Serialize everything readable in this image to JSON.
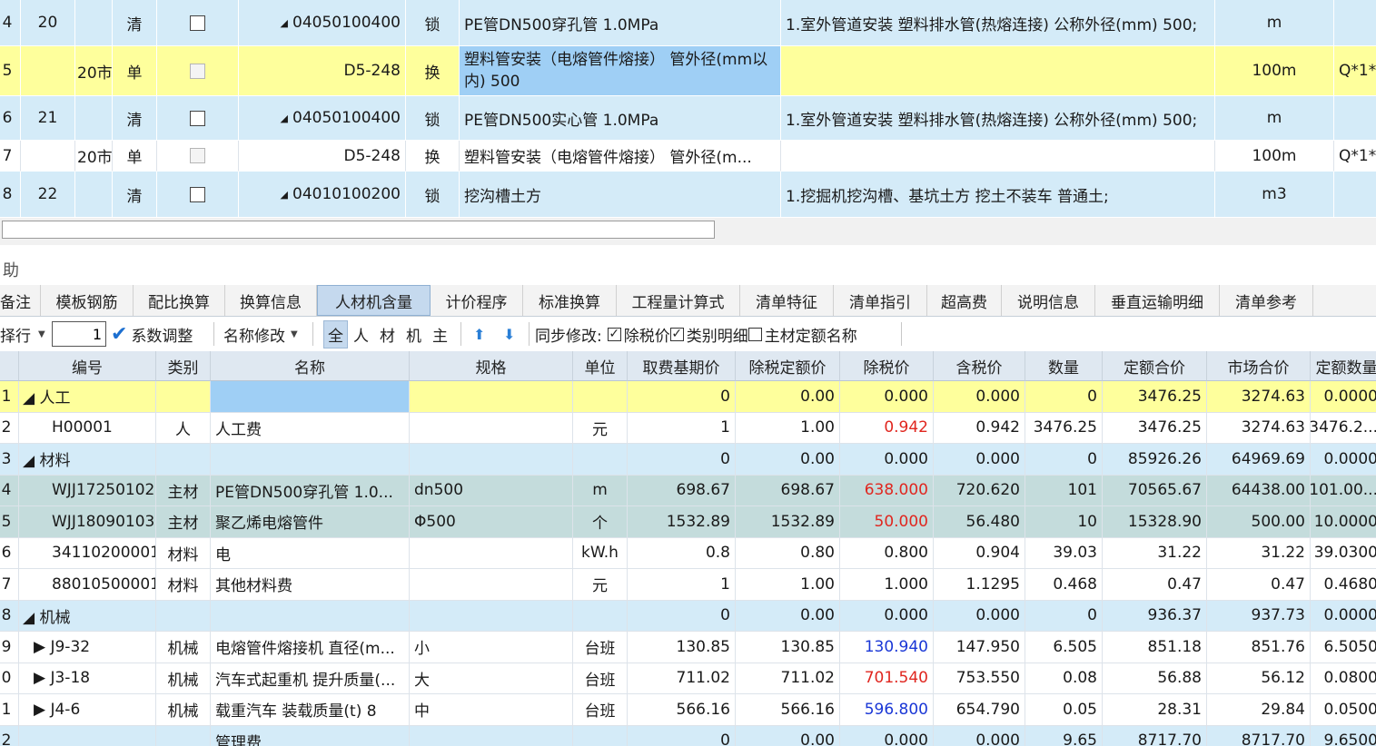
{
  "top_rows": [
    {
      "idx": "4",
      "seq": "20",
      "c2": "",
      "type": "清",
      "check": "unchecked",
      "expand": "◢",
      "code": "04050100400",
      "lock": "锁",
      "name": "PE管DN500穿孔管  1.0MPa",
      "feature": "1.室外管道安装 塑料排水管(热熔连接) 公称外径(mm) 500;",
      "unit": "m",
      "expr": "",
      "style": "blue"
    },
    {
      "idx": "5",
      "seq": "",
      "c2": "20市",
      "type": "单",
      "check": "disabled",
      "expand": "",
      "code": "D5-248",
      "lock": "换",
      "name": "塑料管安装（电熔管件熔接） 管外径(mm以内) 500",
      "feature": "",
      "unit": "100m",
      "expr": "Q*1*",
      "style": "yellow"
    },
    {
      "idx": "6",
      "seq": "21",
      "c2": "",
      "type": "清",
      "check": "unchecked",
      "expand": "◢",
      "code": "04050100400",
      "lock": "锁",
      "name": "PE管DN500实心管  1.0MPa",
      "feature": "1.室外管道安装 塑料排水管(热熔连接) 公称外径(mm) 500;",
      "unit": "m",
      "expr": "",
      "style": "blue"
    },
    {
      "idx": "7",
      "seq": "",
      "c2": "20市",
      "type": "单",
      "check": "disabled",
      "expand": "",
      "code": "D5-248",
      "lock": "换",
      "name": "塑料管安装（电熔管件熔接） 管外径(m...",
      "feature": "",
      "unit": "100m",
      "expr": "Q*1*",
      "style": "white"
    },
    {
      "idx": "8",
      "seq": "22",
      "c2": "",
      "type": "清",
      "check": "unchecked",
      "expand": "◢",
      "code": "04010100200",
      "lock": "锁",
      "name": "挖沟槽土方",
      "feature": "1.挖掘机挖沟槽、基坑土方 挖土不装车 普通土;",
      "unit": "m3",
      "expr": "",
      "style": "blue"
    }
  ],
  "panel": {
    "title": "助"
  },
  "tabs": [
    "备注",
    "模板钢筋",
    "配比换算",
    "换算信息",
    "人材机含量",
    "计价程序",
    "标准换算",
    "工程量计算式",
    "清单特征",
    "清单指引",
    "超高费",
    "说明信息",
    "垂直运输明细",
    "清单参考"
  ],
  "active_tab": "人材机含量",
  "toolbar": {
    "insert_label": "择行",
    "count_value": "1",
    "coef_label": "系数调整",
    "rename_label": "名称修改",
    "filters": [
      "全",
      "人",
      "材",
      "机",
      "主"
    ],
    "sync_label": "同步修改:",
    "opt1": "除税价",
    "opt2": "类别明细",
    "opt3": "主材定额名称"
  },
  "columns": [
    "",
    "编号",
    "类别",
    "名称",
    "规格",
    "单位",
    "取费基期价",
    "除税定额价",
    "除税价",
    "含税价",
    "数量",
    "定额合价",
    "市场合价",
    "定额数量"
  ],
  "rows": [
    {
      "idx": "1",
      "code": "◢ 人工",
      "cat": "",
      "name": "",
      "spec": "",
      "unit": "",
      "base": "0",
      "taxfree_quota": "0.00",
      "taxfree": "0.000",
      "tax": "0.000",
      "qty": "0",
      "quota_total": "3476.25",
      "market_total": "3274.63",
      "quota_qty": "0.0000",
      "style": "yellow",
      "price_color": "black"
    },
    {
      "idx": "2",
      "code": "H00001",
      "cat": "人",
      "name": "人工费",
      "spec": "",
      "unit": "元",
      "base": "1",
      "taxfree_quota": "1.00",
      "taxfree": "0.942",
      "tax": "0.942",
      "qty": "3476.25",
      "quota_total": "3476.25",
      "market_total": "3274.63",
      "quota_qty": "3476.2...",
      "style": "white",
      "price_color": "red"
    },
    {
      "idx": "3",
      "code": "◢ 材料",
      "cat": "",
      "name": "",
      "spec": "",
      "unit": "",
      "base": "0",
      "taxfree_quota": "0.00",
      "taxfree": "0.000",
      "tax": "0.000",
      "qty": "0",
      "quota_total": "85926.26",
      "market_total": "64969.69",
      "quota_qty": "0.0000",
      "style": "blue",
      "price_color": "black"
    },
    {
      "idx": "4",
      "code": "WJJ17250102",
      "cat": "主材",
      "name": "PE管DN500穿孔管  1.0...",
      "spec": "dn500",
      "unit": "m",
      "base": "698.67",
      "taxfree_quota": "698.67",
      "taxfree": "638.000",
      "tax": "720.620",
      "qty": "101",
      "quota_total": "70565.67",
      "market_total": "64438.00",
      "quota_qty": "101.00...",
      "style": "gray",
      "price_color": "red"
    },
    {
      "idx": "5",
      "code": "WJJ18090103",
      "cat": "主材",
      "name": "聚乙烯电熔管件",
      "spec": "Φ500",
      "unit": "个",
      "base": "1532.89",
      "taxfree_quota": "1532.89",
      "taxfree": "50.000",
      "tax": "56.480",
      "qty": "10",
      "quota_total": "15328.90",
      "market_total": "500.00",
      "quota_qty": "10.0000",
      "style": "gray",
      "price_color": "red"
    },
    {
      "idx": "6",
      "code": "34110200001",
      "cat": "材料",
      "name": "电",
      "spec": "",
      "unit": "kW.h",
      "base": "0.8",
      "taxfree_quota": "0.80",
      "taxfree": "0.800",
      "tax": "0.904",
      "qty": "39.03",
      "quota_total": "31.22",
      "market_total": "31.22",
      "quota_qty": "39.0300",
      "style": "white",
      "price_color": "black"
    },
    {
      "idx": "7",
      "code": "88010500001",
      "cat": "材料",
      "name": "其他材料费",
      "spec": "",
      "unit": "元",
      "base": "1",
      "taxfree_quota": "1.00",
      "taxfree": "1.000",
      "tax": "1.1295",
      "qty": "0.468",
      "quota_total": "0.47",
      "market_total": "0.47",
      "quota_qty": "0.4680",
      "style": "white",
      "price_color": "black"
    },
    {
      "idx": "8",
      "code": "◢ 机械",
      "cat": "",
      "name": "",
      "spec": "",
      "unit": "",
      "base": "0",
      "taxfree_quota": "0.00",
      "taxfree": "0.000",
      "tax": "0.000",
      "qty": "0",
      "quota_total": "936.37",
      "market_total": "937.73",
      "quota_qty": "0.0000",
      "style": "blue",
      "price_color": "black"
    },
    {
      "idx": "9",
      "code": "▶ J9-32",
      "cat": "机械",
      "name": "电熔管件熔接机 直径(m...",
      "spec": "小",
      "unit": "台班",
      "base": "130.85",
      "taxfree_quota": "130.85",
      "taxfree": "130.940",
      "tax": "147.950",
      "qty": "6.505",
      "quota_total": "851.18",
      "market_total": "851.76",
      "quota_qty": "6.5050",
      "style": "white",
      "price_color": "blue"
    },
    {
      "idx": "0",
      "code": "▶ J3-18",
      "cat": "机械",
      "name": "汽车式起重机 提升质量(...",
      "spec": "大",
      "unit": "台班",
      "base": "711.02",
      "taxfree_quota": "711.02",
      "taxfree": "701.540",
      "tax": "753.550",
      "qty": "0.08",
      "quota_total": "56.88",
      "market_total": "56.12",
      "quota_qty": "0.0800",
      "style": "white",
      "price_color": "red"
    },
    {
      "idx": "1",
      "code": "▶ J4-6",
      "cat": "机械",
      "name": "载重汽车 装载质量(t) 8",
      "spec": "中",
      "unit": "台班",
      "base": "566.16",
      "taxfree_quota": "566.16",
      "taxfree": "596.800",
      "tax": "654.790",
      "qty": "0.05",
      "quota_total": "28.31",
      "market_total": "29.84",
      "quota_qty": "0.0500",
      "style": "white",
      "price_color": "blue"
    },
    {
      "idx": "2",
      "code": "",
      "cat": "",
      "name": "管理费",
      "spec": "",
      "unit": "",
      "base": "0",
      "taxfree_quota": "0.00",
      "taxfree": "0.000",
      "tax": "0.000",
      "qty": "9.65",
      "quota_total": "8717.70",
      "market_total": "8717.70",
      "quota_qty": "9.6500",
      "style": "blue",
      "price_color": "black"
    }
  ],
  "colors": {
    "blue_row": "#d4ebf8",
    "yellow_row": "#feff9c",
    "gray_row": "#c4dcdc",
    "selected": "#9fcff5",
    "red": "#e0261f",
    "blue_text": "#1a37d6"
  }
}
